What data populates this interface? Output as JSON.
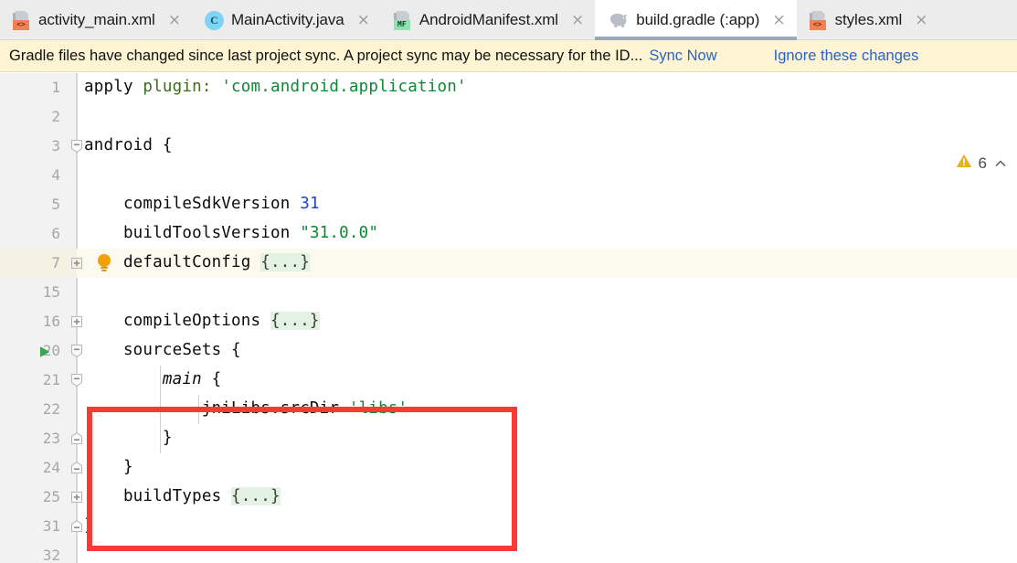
{
  "tabs": [
    {
      "label": "activity_main.xml",
      "icon": "xml-layout-icon",
      "badge": "<>",
      "active": false,
      "close": "×"
    },
    {
      "label": "MainActivity.java",
      "icon": "java-class-icon",
      "badge": "C",
      "active": false,
      "close": "×"
    },
    {
      "label": "AndroidManifest.xml",
      "icon": "android-manifest-icon",
      "badge": "MF",
      "active": false,
      "close": "×"
    },
    {
      "label": "build.gradle (:app)",
      "icon": "gradle-elephant-icon",
      "badge": "",
      "active": true,
      "close": "×"
    },
    {
      "label": "styles.xml",
      "icon": "xml-values-icon",
      "badge": "<>",
      "active": false,
      "close": "×"
    }
  ],
  "notification": {
    "message": "Gradle files have changed since last project sync. A project sync may be necessary for the ID...",
    "sync_link": "Sync Now",
    "ignore_link": "Ignore these changes",
    "background": "#fcf4d3"
  },
  "inspection": {
    "warning_count": "6",
    "warning_color": "#e8b014",
    "collapse_glyph": "⌃"
  },
  "editor": {
    "filename": "build.gradle (:app)",
    "lines": [
      {
        "num": "1",
        "indent": 0,
        "fold": "",
        "text": "apply plugin: 'com.android.application'"
      },
      {
        "num": "2",
        "indent": 0,
        "fold": "",
        "text": ""
      },
      {
        "num": "3",
        "indent": 0,
        "fold": "expand",
        "text": "android {"
      },
      {
        "num": "4",
        "indent": 0,
        "fold": "",
        "text": ""
      },
      {
        "num": "5",
        "indent": 1,
        "fold": "",
        "text": "    compileSdkVersion 31"
      },
      {
        "num": "6",
        "indent": 1,
        "fold": "",
        "text": "    buildToolsVersion \"31.0.0\""
      },
      {
        "num": "7",
        "indent": 1,
        "fold": "collapsed",
        "text": "    defaultConfig {...}",
        "current": true,
        "bulb": true
      },
      {
        "num": "15",
        "indent": 1,
        "fold": "",
        "text": ""
      },
      {
        "num": "16",
        "indent": 1,
        "fold": "collapsed",
        "text": "    compileOptions {...}"
      },
      {
        "num": "20",
        "indent": 1,
        "fold": "expand",
        "text": "    sourceSets {",
        "run": true
      },
      {
        "num": "21",
        "indent": 2,
        "fold": "expand",
        "text": "        main {"
      },
      {
        "num": "22",
        "indent": 3,
        "fold": "",
        "text": "            jniLibs.srcDir 'libs'"
      },
      {
        "num": "23",
        "indent": 2,
        "fold": "end",
        "text": "        }"
      },
      {
        "num": "24",
        "indent": 1,
        "fold": "end",
        "text": "    }"
      },
      {
        "num": "25",
        "indent": 1,
        "fold": "collapsed",
        "text": "    buildTypes {...}"
      },
      {
        "num": "31",
        "indent": 0,
        "fold": "end",
        "text": "}"
      },
      {
        "num": "32",
        "indent": 0,
        "fold": "",
        "text": ""
      }
    ],
    "tokens": {
      "line1_apply": "apply ",
      "line1_plugin": "plugin:",
      "line1_string": " 'com.android.application'",
      "line3": "android {",
      "line5_name": "    compileSdkVersion ",
      "line5_num": "31",
      "line6_name": "    buildToolsVersion ",
      "line6_str": "\"31.0.0\"",
      "line7_name": "    defaultConfig ",
      "line7_fold": "{...}",
      "line16_name": "    compileOptions ",
      "line16_fold": "{...}",
      "line20": "    sourceSets {",
      "line21_ital": "main",
      "line21_pre": "        ",
      "line21_post": " {",
      "line22_name": "            jniLibs.srcDir ",
      "line22_str": "'libs'",
      "line23": "        }",
      "line24": "    }",
      "line25_name": "    buildTypes ",
      "line25_fold": "{...}",
      "line31": "}"
    },
    "highlight_box": {
      "name": "red-annotation-rectangle",
      "color": "#f93a35",
      "covers_lines": "20-24"
    }
  }
}
